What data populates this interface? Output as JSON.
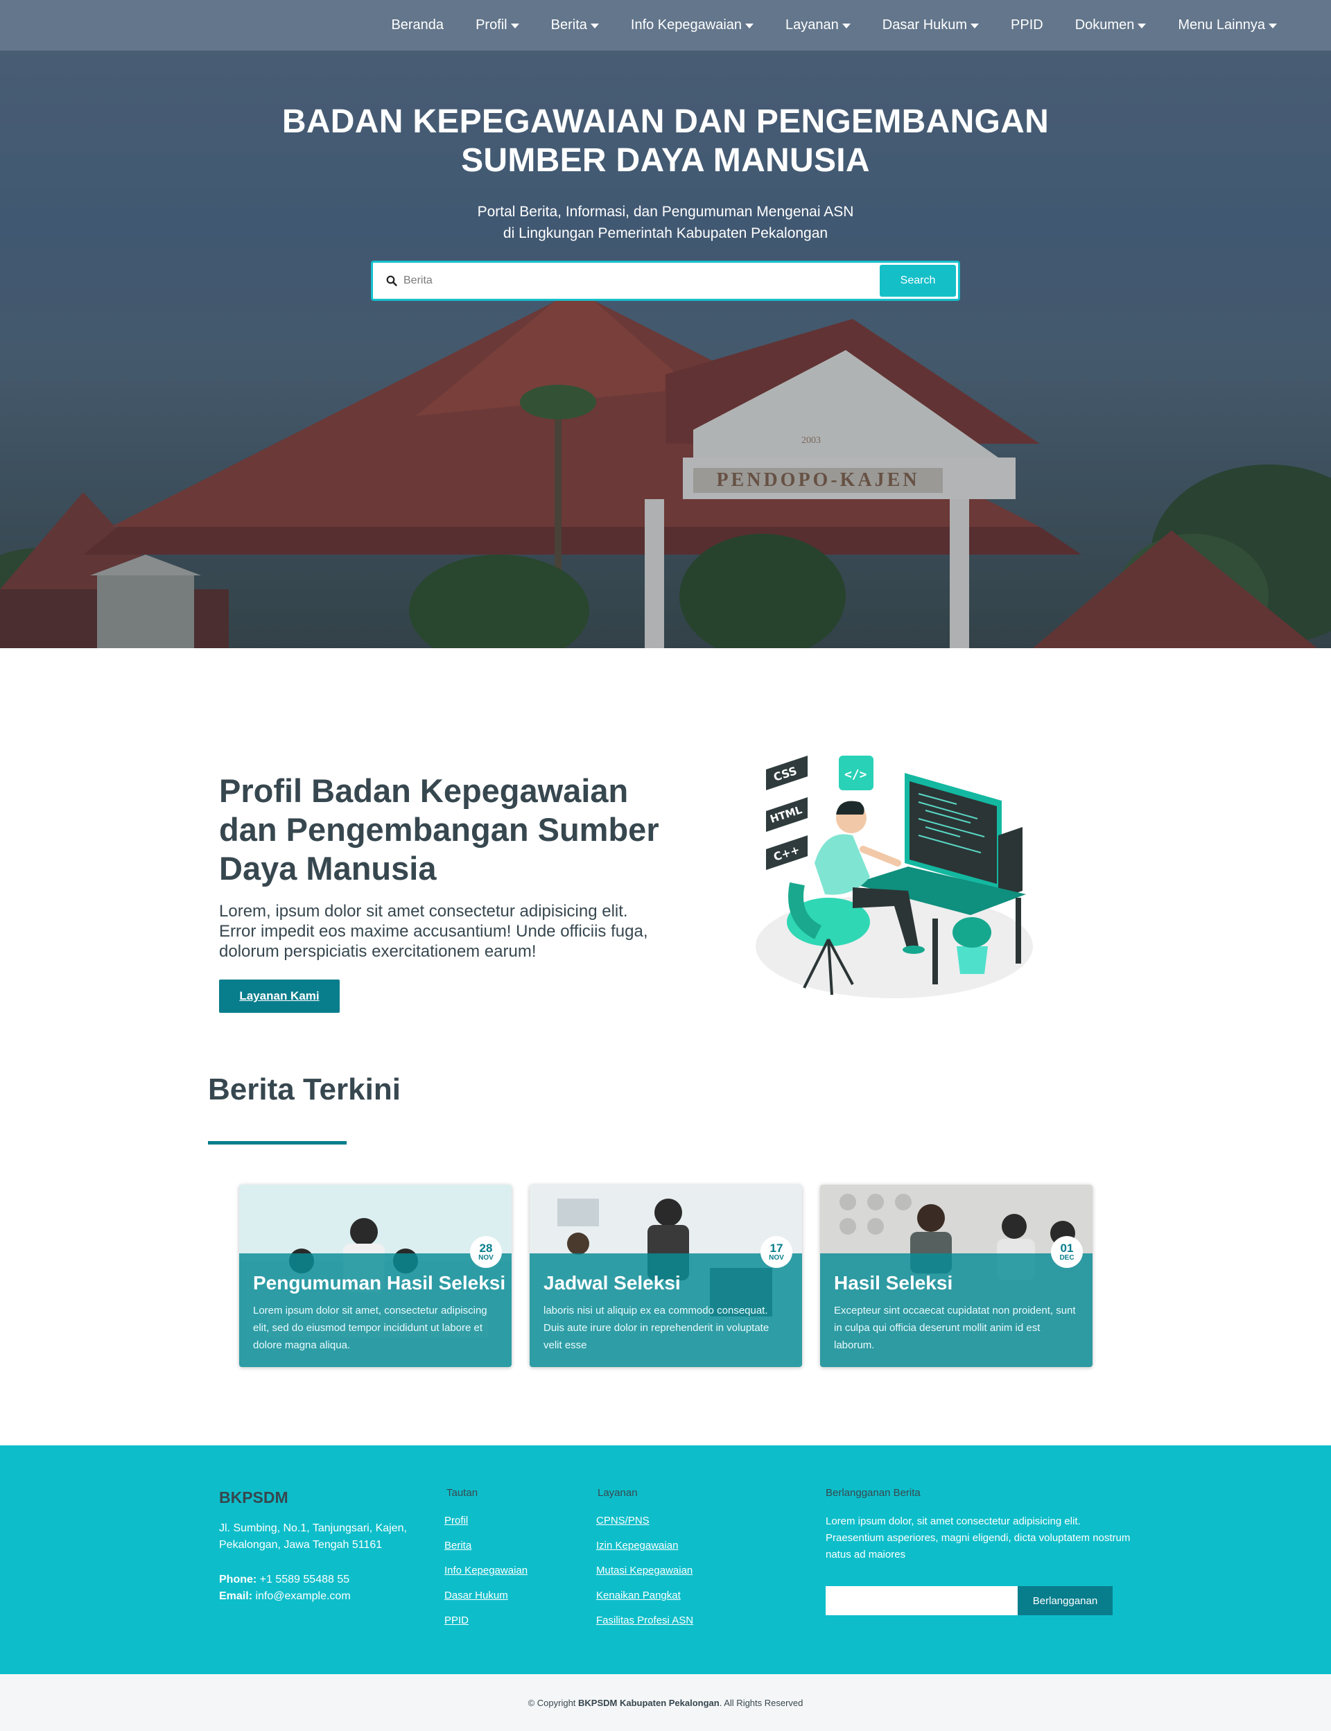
{
  "nav": {
    "items": [
      {
        "label": "Beranda",
        "dropdown": false
      },
      {
        "label": "Profil",
        "dropdown": true
      },
      {
        "label": "Berita",
        "dropdown": true
      },
      {
        "label": "Info Kepegawaian",
        "dropdown": true
      },
      {
        "label": "Layanan",
        "dropdown": true
      },
      {
        "label": "Dasar Hukum",
        "dropdown": true
      },
      {
        "label": "PPID",
        "dropdown": false
      },
      {
        "label": "Dokumen",
        "dropdown": true
      },
      {
        "label": "Menu Lainnya",
        "dropdown": true
      }
    ]
  },
  "hero": {
    "title_line1": "BADAN KEPEGAWAIAN DAN PENGEMBANGAN",
    "title_line2": "SUMBER DAYA MANUSIA",
    "subtitle_line1": "Portal Berita, Informasi, dan Pengumuman Mengenai ASN",
    "subtitle_line2": "di Lingkungan Pemerintah Kabupaten Pekalongan",
    "search_placeholder": "Berita",
    "search_button": "Search",
    "building_sign": "PENDOPO-KAJEN",
    "building_year": "2003"
  },
  "profile": {
    "title": "Profil Badan Kepegawaian dan Pengembangan Sumber Daya Manusia",
    "text": "Lorem, ipsum dolor sit amet consectetur adipisicing elit. Error impedit eos maxime accusantium! Unde officiis fuga, dolorum perspiciatis exercitationem earum!",
    "button": "Layanan Kami",
    "illus_tags": [
      "CSS",
      "HTML",
      "C++"
    ]
  },
  "news": {
    "heading": "Berita Terkini",
    "cards": [
      {
        "day": "28",
        "month": "NOV",
        "title": "Pengumuman Hasil Seleksi",
        "text": "Lorem ipsum dolor sit amet, consectetur adipiscing elit, sed do eiusmod tempor incididunt ut labore et dolore magna aliqua."
      },
      {
        "day": "17",
        "month": "NOV",
        "title": "Jadwal Seleksi",
        "text": "laboris nisi ut aliquip ex ea commodo consequat. Duis aute irure dolor in reprehenderit in voluptate velit esse"
      },
      {
        "day": "01",
        "month": "DEC",
        "title": "Hasil Seleksi",
        "text": "Excepteur sint occaecat cupidatat non proident, sunt in culpa qui officia deserunt mollit anim id est laborum."
      }
    ]
  },
  "footer": {
    "brand": "BKPSDM",
    "address": "Jl. Sumbing, No.1, Tanjungsari, Kajen, Pekalongan, Jawa Tengah 51161",
    "phone_label": "Phone:",
    "phone": "+1 5589 55488 55",
    "email_label": "Email:",
    "email": "info@example.com",
    "links_title": "Tautan",
    "links": [
      "Profil",
      "Berita",
      "Info Kepegawaian",
      "Dasar Hukum",
      "PPID"
    ],
    "services_title": "Layanan",
    "services": [
      "CPNS/PNS",
      "Izin Kepegawaian",
      "Mutasi Kepegawaian",
      "Kenaikan Pangkat",
      "Fasilitas Profesi ASN"
    ],
    "subscribe_title": "Berlangganan Berita",
    "subscribe_text": "Lorem ipsum dolor, sit amet consectetur adipisicing elit. Praesentium asperiores, magni eligendi, dicta voluptatem nostrum natus ad maiores",
    "subscribe_button": "Berlangganan"
  },
  "copyright": {
    "prefix": "© Copyright",
    "org": "BKPSDM Kabupaten Pekalongan",
    "suffix": ". All Rights Reserved"
  },
  "colors": {
    "accent": "#0dbeca",
    "dark_teal": "#087d8c",
    "text_dark": "#37474f"
  }
}
